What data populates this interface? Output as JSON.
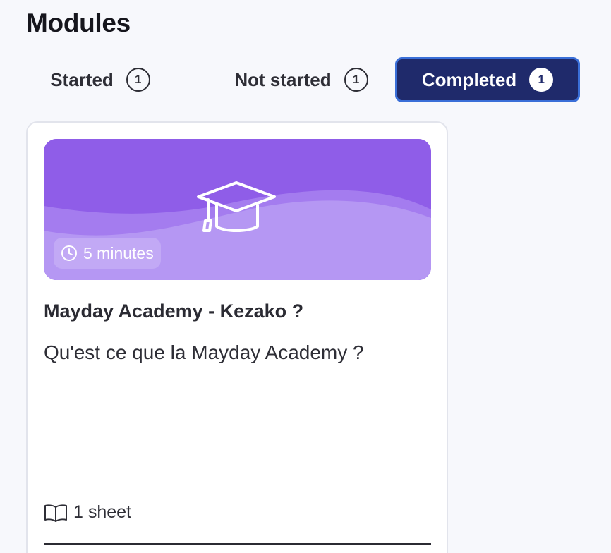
{
  "page": {
    "title": "Modules"
  },
  "tabs": [
    {
      "label": "Started",
      "count": "1",
      "active": false
    },
    {
      "label": "Not started",
      "count": "1",
      "active": false
    },
    {
      "label": "Completed",
      "count": "1",
      "active": true
    }
  ],
  "colors": {
    "active_tab_bg": "#1f2a6b",
    "active_tab_border": "#3a6fd8",
    "banner_purple": "#8f5de8",
    "banner_wave_light": "#b597f3"
  },
  "modules": [
    {
      "duration": "5 minutes",
      "duration_icon": "clock-icon",
      "banner_icon": "graduation-cap-icon",
      "title": "Mayday Academy - Kezako ?",
      "description": "Qu'est ce que la Mayday Academy ?",
      "sheets": "1 sheet",
      "sheets_icon": "book-icon"
    }
  ]
}
